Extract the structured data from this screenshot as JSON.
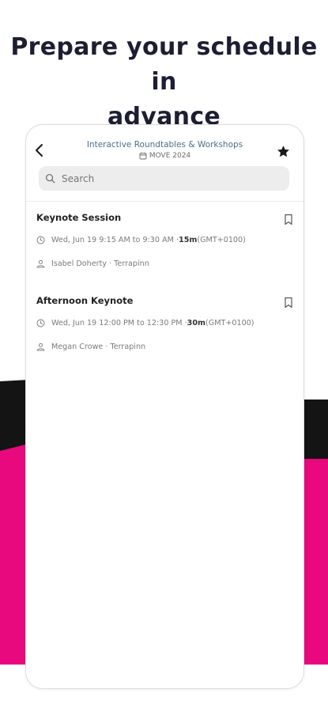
{
  "headline": {
    "line1": "Prepare your schedule in",
    "line2": "advance"
  },
  "app": {
    "title": "Interactive Roundtables & Workshops",
    "event": "MOVE 2024"
  },
  "search": {
    "placeholder": "Search"
  },
  "sessions": [
    {
      "title": "Keynote Session",
      "time_range": "Wed, Jun 19 9:15 AM to 9:30 AM · ",
      "duration": "15m",
      "timezone": " (GMT+0100)",
      "speaker": "Isabel Doherty · Terrapinn"
    },
    {
      "title": "Afternoon Keynote",
      "time_range": "Wed, Jun 19 12:00 PM to 12:30 PM · ",
      "duration": "30m",
      "timezone": " (GMT+0100)",
      "speaker": "Megan Crowe · Terrapinn"
    }
  ],
  "icons": {
    "back": "chevron-left-icon",
    "favorite": "star-icon",
    "search": "search-icon",
    "calendar": "calendar-icon",
    "clock": "clock-icon",
    "person": "person-icon",
    "bookmark": "bookmark-icon"
  },
  "colors": {
    "headline": "#1c1e33",
    "accent_pink": "#e8097e",
    "dark_band": "#141414",
    "app_title": "#4a6f8a"
  }
}
